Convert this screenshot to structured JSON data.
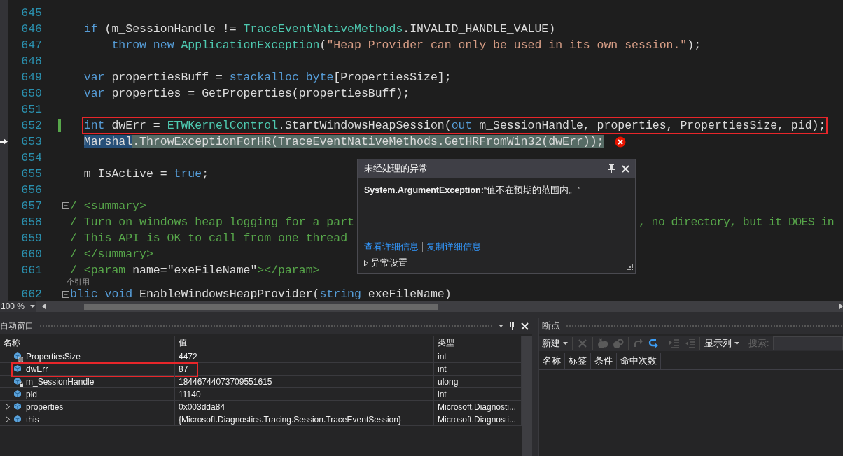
{
  "editor": {
    "lines": [
      {
        "number": "645",
        "current": false,
        "changed": false,
        "collapsible": false,
        "boxed": false
      },
      {
        "number": "646",
        "current": false,
        "changed": false,
        "collapsible": false,
        "boxed": false,
        "tokens": [
          {
            "kind": "keyword",
            "text": "  if"
          },
          {
            "kind": "plain",
            "text": " (m_SessionHandle != "
          },
          {
            "kind": "type",
            "text": "TraceEventNativeMethods"
          },
          {
            "kind": "plain",
            "text": ".INVALID_HANDLE_VALUE)"
          }
        ]
      },
      {
        "number": "647",
        "current": false,
        "changed": false,
        "collapsible": false,
        "boxed": false,
        "tokens": [
          {
            "kind": "keyword",
            "text": "      throw new"
          },
          {
            "kind": "type",
            "text": " ApplicationException"
          },
          {
            "kind": "plain",
            "text": "("
          },
          {
            "kind": "string",
            "text": "\"Heap Provider can only be used in its own session.\""
          },
          {
            "kind": "plain",
            "text": ");"
          }
        ]
      },
      {
        "number": "648",
        "current": false,
        "changed": false,
        "collapsible": false,
        "boxed": false
      },
      {
        "number": "649",
        "current": false,
        "changed": false,
        "collapsible": false,
        "boxed": false,
        "tokens": [
          {
            "kind": "keyword",
            "text": "  var"
          },
          {
            "kind": "plain",
            "text": " propertiesBuff = "
          },
          {
            "kind": "keyword",
            "text": "stackalloc byte"
          },
          {
            "kind": "plain",
            "text": "[PropertiesSize];"
          }
        ]
      },
      {
        "number": "650",
        "current": false,
        "changed": false,
        "collapsible": false,
        "boxed": false,
        "tokens": [
          {
            "kind": "keyword",
            "text": "  var"
          },
          {
            "kind": "plain",
            "text": " properties = GetProperties(propertiesBuff);"
          }
        ]
      },
      {
        "number": "651",
        "current": false,
        "changed": false,
        "collapsible": false,
        "boxed": false
      },
      {
        "number": "652",
        "current": false,
        "changed": true,
        "collapsible": false,
        "boxed": true,
        "tokens": [
          {
            "kind": "keyword",
            "text": "  int"
          },
          {
            "kind": "plain",
            "text": " dwErr = "
          },
          {
            "kind": "type",
            "text": "ETWKernelControl"
          },
          {
            "kind": "plain",
            "text": ".StartWindowsHeapSession("
          },
          {
            "kind": "keyword",
            "text": "out"
          },
          {
            "kind": "plain",
            "text": " m_SessionHandle, properties, PropertiesSize, pid);"
          }
        ]
      },
      {
        "number": "653",
        "current": true,
        "changed": false,
        "collapsible": false,
        "boxed": false,
        "tokens": [
          {
            "kind": "selection",
            "text": "  Marshal"
          },
          {
            "kind": "plain",
            "text": ".ThrowExceptionForHR(TraceEventNativeMethods.GetHRFromWin32(dwErr));"
          }
        ]
      },
      {
        "number": "654",
        "current": false,
        "changed": false,
        "collapsible": false,
        "boxed": false
      },
      {
        "number": "655",
        "current": false,
        "changed": false,
        "collapsible": false,
        "boxed": false,
        "tokens": [
          {
            "kind": "plain",
            "text": "  m_IsActive = "
          },
          {
            "kind": "keyword",
            "text": "true"
          },
          {
            "kind": "plain",
            "text": ";"
          }
        ]
      },
      {
        "number": "656",
        "current": false,
        "changed": false,
        "collapsible": false,
        "boxed": false
      },
      {
        "number": "657",
        "current": false,
        "changed": false,
        "collapsible": true,
        "boxed": false,
        "tokens": [
          {
            "kind": "comment",
            "text": "/ <summary>"
          }
        ]
      },
      {
        "number": "658",
        "current": false,
        "changed": false,
        "collapsible": false,
        "boxed": false,
        "tokens": [
          {
            "kind": "comment",
            "text": "/ Turn on windows heap logging for a part"
          }
        ],
        "tokens_after_popup": [
          {
            "kind": "comment",
            "text": ", no directory, but it DOES in"
          }
        ]
      },
      {
        "number": "659",
        "current": false,
        "changed": false,
        "collapsible": false,
        "boxed": false,
        "tokens": [
          {
            "kind": "comment",
            "text": "/ This API is OK to call from one thread"
          }
        ]
      },
      {
        "number": "660",
        "current": false,
        "changed": false,
        "collapsible": false,
        "boxed": false,
        "tokens": [
          {
            "kind": "comment",
            "text": "/ </summary>"
          }
        ]
      },
      {
        "number": "661",
        "current": false,
        "changed": false,
        "collapsible": false,
        "boxed": false,
        "tokens": [
          {
            "kind": "comment",
            "text": "/ <param "
          },
          {
            "kind": "plain",
            "text": "name=\"exeFileName\""
          },
          {
            "kind": "comment",
            "text": "></param>"
          }
        ]
      },
      {
        "kind": "codelens",
        "text": "个引用"
      },
      {
        "number": "662",
        "current": false,
        "changed": false,
        "collapsible": true,
        "boxed": false,
        "tokens": [
          {
            "kind": "keyword",
            "text": "blic void"
          },
          {
            "kind": "plain",
            "text": " EnableWindowsHeapProvider("
          },
          {
            "kind": "keyword",
            "text": "string"
          },
          {
            "kind": "plain",
            "text": " exeFileName)"
          }
        ]
      }
    ],
    "zoom": "100 %"
  },
  "exception_popup": {
    "title": "未经处理的异常",
    "message": "**System.ArgumentException:**“值不在预期的范围内。”",
    "links": [
      "查看详细信息",
      "复制详细信息"
    ],
    "settings": {
      "label": "异常设置",
      "expanded": false
    }
  },
  "autos": {
    "title": "自动窗口",
    "columns": [
      "名称",
      "值",
      "类型"
    ],
    "rows": [
      {
        "name": "PropertiesSize",
        "value": "4472",
        "type": "int",
        "kind": "constant",
        "has_children": false,
        "highlighted": false
      },
      {
        "name": "dwErr",
        "value": "87",
        "type": "int",
        "kind": "local",
        "has_children": false,
        "highlighted": true
      },
      {
        "name": "m_SessionHandle",
        "value": "18446744073709551615",
        "type": "ulong",
        "kind": "private",
        "has_children": false,
        "highlighted": false
      },
      {
        "name": "pid",
        "value": "11140",
        "type": "int",
        "kind": "local",
        "has_children": false,
        "highlighted": false
      },
      {
        "name": "properties",
        "value": "0x003dda84",
        "type": "Microsoft.Diagnosti...",
        "kind": "local",
        "has_children": true,
        "highlighted": false
      },
      {
        "name": "this",
        "value": "{Microsoft.Diagnostics.Tracing.Session.TraceEventSession}",
        "type": "Microsoft.Diagnosti...",
        "kind": "local",
        "has_children": true,
        "highlighted": false
      }
    ]
  },
  "breakpoints": {
    "title": "断点",
    "toolbar": [
      {
        "kind": "dropdown",
        "label": "新建"
      },
      {
        "kind": "separator"
      },
      {
        "kind": "icon",
        "disabled": true
      },
      {
        "kind": "separator"
      },
      {
        "kind": "icon",
        "disabled": true
      },
      {
        "kind": "icon",
        "disabled": true
      },
      {
        "kind": "separator"
      },
      {
        "kind": "icon",
        "disabled": true
      },
      {
        "kind": "icon",
        "disabled": false
      },
      {
        "kind": "separator"
      },
      {
        "kind": "icon",
        "disabled": true
      },
      {
        "kind": "icon",
        "disabled": true
      },
      {
        "kind": "separator"
      },
      {
        "kind": "dropdown",
        "label": "显示列"
      },
      {
        "kind": "separator"
      }
    ],
    "search": {
      "label": "搜索:",
      "disabled": true
    },
    "columns": [
      "名称",
      "标签",
      "条件",
      "命中次数"
    ]
  }
}
